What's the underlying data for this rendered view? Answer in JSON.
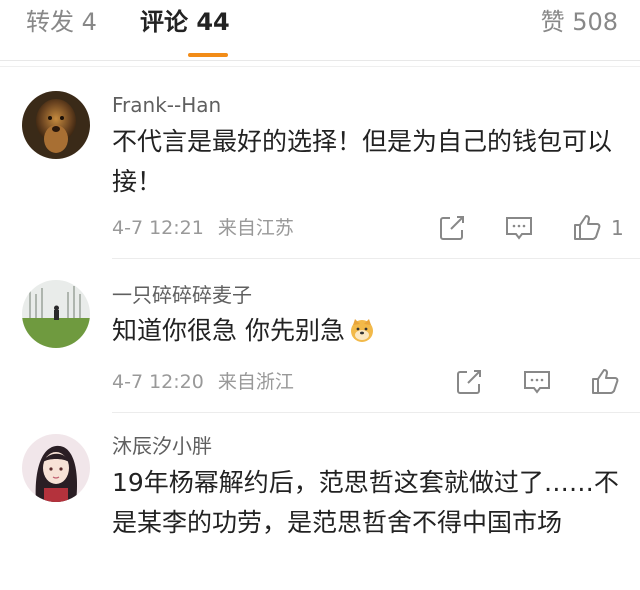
{
  "tabs": {
    "repost": "转发 4",
    "comment": "评论 44",
    "likes": "赞 508"
  },
  "comments": [
    {
      "username": "Frank--Han",
      "text": "不代言是最好的选择！但是为自己的钱包可以接！",
      "time": "4-7 12:21",
      "location": "来自江苏",
      "like_count": "1"
    },
    {
      "username": "一只碎碎碎麦子",
      "text": "知道你很急 你先别急",
      "emoji": "doge-emoji",
      "time": "4-7 12:20",
      "location": "来自浙江"
    },
    {
      "username": "沐辰汐小胖",
      "text": "19年杨幂解约后，范思哲这套就做过了……不是某李的功劳，是范思哲舍不得中国市场"
    }
  ],
  "icons": [
    "repost-icon",
    "comment-icon",
    "thumbs-up-icon"
  ],
  "colors": {
    "accent": "#f28c18",
    "meta": "#999999",
    "text": "#222222"
  }
}
